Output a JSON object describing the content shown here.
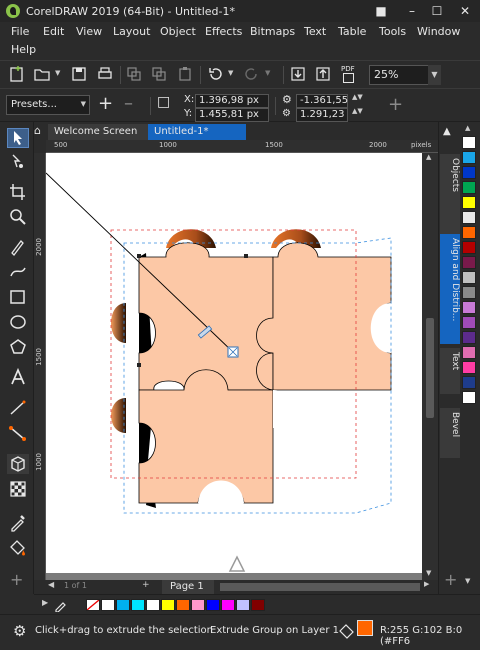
{
  "window": {
    "title": "CorelDRAW 2019 (64-Bit) - Untitled-1*"
  },
  "menu": {
    "items": [
      "File",
      "Edit",
      "View",
      "Layout",
      "Object",
      "Effects",
      "Bitmaps",
      "Text",
      "Table",
      "Tools",
      "Window",
      "Help"
    ]
  },
  "toolbar": {
    "zoom_value": "25%",
    "pdf_label": "PDF"
  },
  "propertybar": {
    "presets_value": "Presets...",
    "x_label": "X:",
    "x_value": "1.396,98 px",
    "y_label": "Y:",
    "y_value": "1.455,81 px",
    "vp_x_value": "-1.361,55 p",
    "vp_y_value": "1.291,23 px"
  },
  "tabs": {
    "welcome": "Welcome Screen",
    "doc": "Untitled-1*"
  },
  "ruler": {
    "h_ticks": [
      "500",
      "1000",
      "1500",
      "2000"
    ],
    "h_unit": "pixels",
    "v_ticks": [
      "2000",
      "1500",
      "1000"
    ]
  },
  "dockers": {
    "objects": "Objects",
    "align": "Align and Distrib...",
    "text": "Text",
    "bevel": "Bevel"
  },
  "pagebar": {
    "page_label": "Page 1",
    "page_count": "1 of 1"
  },
  "status": {
    "hint": "Click+drag to extrude the selection",
    "object_info": "Extrude Group on Layer 1",
    "color_info": "R:255 G:102 B:0 (#FF6"
  },
  "colors": {
    "accent": "#FF6600",
    "puzzle_fill": "#FBC7A6",
    "selection_blue": "#2e6fb6"
  },
  "palette_right": [
    "#ffffff",
    "#1aa6e8",
    "#0037c8",
    "#00a651",
    "#ffff00",
    "#e8e8e8",
    "#ff6600",
    "#b50000",
    "#7a1a4b",
    "#c0c0c0",
    "#8a8a8a",
    "#c87ad6",
    "#a04bb8",
    "#5c2b8c",
    "#e06db1",
    "#ff3da5",
    "#1e3c8c",
    "#ffffff"
  ],
  "palette_bottom": [
    "#ffffff",
    "#00b0f0",
    "#00e5ff",
    "#ffffff",
    "#ffff00",
    "#ff6600",
    "#ff99cc",
    "#0000ff",
    "#ff00ff",
    "#c0c0ff",
    "#800000"
  ]
}
